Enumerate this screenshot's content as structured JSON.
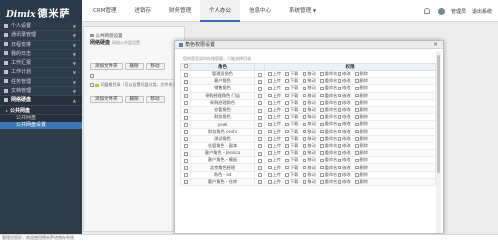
{
  "app": {
    "logo_latin": "Dimix",
    "logo_cn": "德米萨"
  },
  "topnav": {
    "items": [
      "CRM管理",
      "进销存",
      "财务管理",
      "个人办公",
      "信息中心",
      "系统管理"
    ],
    "active_index": 3,
    "user_label": "管理员",
    "logout_label": "退出系统"
  },
  "sidebar": {
    "items": [
      "个人设置",
      "通讯录管理",
      "日程安排",
      "我的日志",
      "工作汇报",
      "工作计划",
      "任务管理",
      "文档管理",
      "网络硬盘"
    ],
    "expanded_label": "公共网盘",
    "sub_items": [
      "公共网盘",
      "公共网盘设置"
    ],
    "active_sub_index": 1
  },
  "content": {
    "breadcrumb": "公共网盘设置",
    "title": "网络硬盘",
    "subtitle": "网络公共盘设置",
    "buttons": [
      "添加文件夹",
      "删除",
      "移动"
    ],
    "row_text": "问盘根目录（可以设置问盘分类，文件夹）"
  },
  "modal": {
    "title": "角色权限设置",
    "hint": "您的是否实时存储容量，只能选择目录",
    "col_role": "角色",
    "col_perm": "权限",
    "permissions": [
      "上传",
      "下载",
      "移动",
      "重命名",
      "修改",
      "删除"
    ],
    "roles": [
      "管理员角色",
      "客户角色",
      "销售角色",
      "采购经理角色 门店",
      "采购经理角色",
      "仓管角色",
      "财务角色",
      "yowl",
      "财务角色 ceshi",
      "测试角色",
      "仓管角色 - 副本",
      "客户角色 - Jessica",
      "客户角色 - 模板",
      "北京角色经理",
      "角色 - sd",
      "客户角色 - 仓库"
    ]
  },
  "status": {
    "text": "管理员您好，欢迎使用德米萨进销存系统"
  }
}
